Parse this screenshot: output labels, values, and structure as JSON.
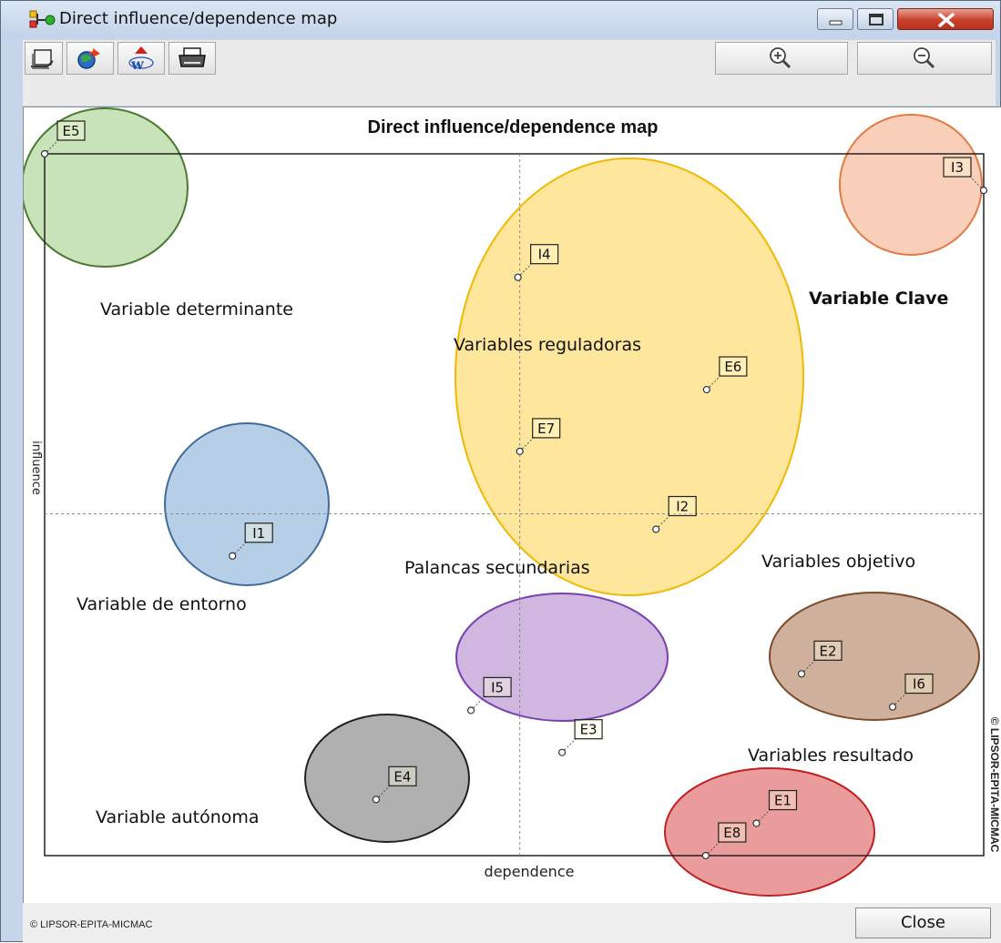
{
  "window": {
    "title": "Direct influence/dependence map",
    "close_label": "Close",
    "copyright": "© LIPSOR-EPITA-MICMAC",
    "colors": {
      "chrome": "#c6d6ea",
      "close_button": "#c7412b"
    },
    "icons": [
      "app-icon",
      "copy-icon",
      "export-icon",
      "word-icon",
      "print-icon",
      "zoom-in-icon",
      "zoom-out-icon"
    ]
  },
  "chart_data": {
    "type": "scatter",
    "title": "Direct influence/dependence map",
    "xlabel": "dependence",
    "ylabel": "influence",
    "grid": false,
    "xlim": [
      0,
      100
    ],
    "ylim": [
      0,
      100
    ],
    "mean_lines": {
      "x": 50.6,
      "y": 48.7
    },
    "watermark": "© LIPSOR-EPITA-MICMAC",
    "points": [
      {
        "label": "E5",
        "x": 0,
        "y": 100
      },
      {
        "label": "I3",
        "x": 100,
        "y": 94.8
      },
      {
        "label": "I4",
        "x": 50.4,
        "y": 82.4
      },
      {
        "label": "E6",
        "x": 70.5,
        "y": 66.4
      },
      {
        "label": "E7",
        "x": 50.6,
        "y": 57.6
      },
      {
        "label": "I2",
        "x": 65.1,
        "y": 46.5
      },
      {
        "label": "I1",
        "x": 20.0,
        "y": 42.7
      },
      {
        "label": "E2",
        "x": 80.6,
        "y": 25.9
      },
      {
        "label": "I6",
        "x": 90.3,
        "y": 21.2
      },
      {
        "label": "I5",
        "x": 45.4,
        "y": 20.7
      },
      {
        "label": "E3",
        "x": 55.1,
        "y": 14.7
      },
      {
        "label": "E4",
        "x": 35.3,
        "y": 8.0
      },
      {
        "label": "E1",
        "x": 75.8,
        "y": 4.6
      },
      {
        "label": "E8",
        "x": 70.4,
        "y": 0
      }
    ],
    "zones": [
      {
        "label": "Variable determinante",
        "color": "#9bcb80",
        "stroke": "#4a7a30"
      },
      {
        "label": "Variable Clave",
        "color": "#f6a77f",
        "stroke": "#e07b42"
      },
      {
        "label": "Variables reguladoras",
        "color": "#ffd24d",
        "stroke": "#f0b800"
      },
      {
        "label": "Variable de entorno",
        "color": "#7aa5d2",
        "stroke": "#3e6b9a"
      },
      {
        "label": "Palancas secundarias",
        "color": "#a97cc7",
        "stroke": "#7a3fb0"
      },
      {
        "label": "Variables objetivo",
        "color": "#a8704a",
        "stroke": "#7a4a2a"
      },
      {
        "label": "Variable autónoma",
        "color": "#707070",
        "stroke": "#222222"
      },
      {
        "label": "Variables resultado",
        "color": "#d94a4a",
        "stroke": "#c02020"
      }
    ]
  }
}
